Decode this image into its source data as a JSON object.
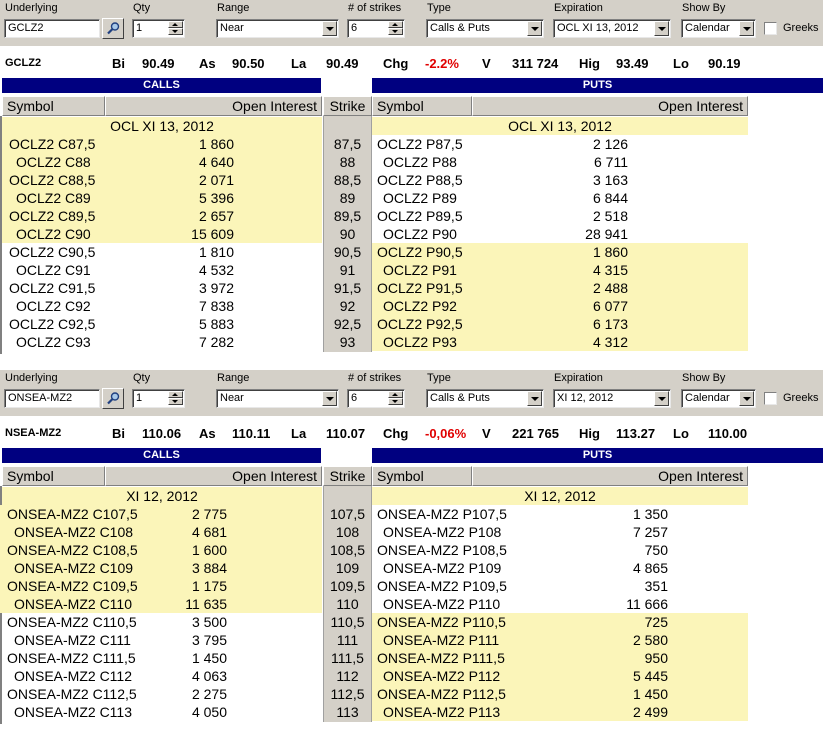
{
  "labels": {
    "underlying": "Underlying",
    "qty": "Qty",
    "range": "Range",
    "strikes": "# of strikes",
    "type": "Type",
    "expiration": "Expiration",
    "show_by": "Show By",
    "greeks": "Greeks",
    "calls": "CALLS",
    "puts": "PUTS",
    "symbol": "Symbol",
    "open_interest": "Open Interest",
    "strike": "Strike",
    "bid": "Bi",
    "ask": "As",
    "last": "La",
    "chg": "Chg",
    "vol": "V",
    "high": "Hig",
    "low": "Lo"
  },
  "panels": [
    {
      "underlying": "GCLZ2",
      "qty": "1",
      "range": "Near",
      "strikes": "6",
      "type": "Calls & Puts",
      "expiration": "OCL XI 13, 2012",
      "show_by": "Calendar",
      "quote": {
        "symbol": "GCLZ2",
        "bid": "90.49",
        "ask": "90.50",
        "last": "90.49",
        "chg": "-2.2%",
        "vol": "311 724",
        "high": "93.49",
        "low": "90.19"
      },
      "expiry_label": "OCL XI 13, 2012",
      "rows": [
        {
          "call": "OCLZ2 C87,5",
          "call_oi": "1 860",
          "strike": "87,5",
          "put": "OCLZ2 P87,5",
          "put_oi": "2 126",
          "call_itm": true,
          "put_itm": false
        },
        {
          "call": "OCLZ2 C88",
          "call_oi": "4 640",
          "strike": "88",
          "put": "OCLZ2 P88",
          "put_oi": "6 711",
          "call_itm": true,
          "put_itm": false
        },
        {
          "call": "OCLZ2 C88,5",
          "call_oi": "2 071",
          "strike": "88,5",
          "put": "OCLZ2 P88,5",
          "put_oi": "3 163",
          "call_itm": true,
          "put_itm": false
        },
        {
          "call": "OCLZ2 C89",
          "call_oi": "5 396",
          "strike": "89",
          "put": "OCLZ2 P89",
          "put_oi": "6 844",
          "call_itm": true,
          "put_itm": false
        },
        {
          "call": "OCLZ2 C89,5",
          "call_oi": "2 657",
          "strike": "89,5",
          "put": "OCLZ2 P89,5",
          "put_oi": "2 518",
          "call_itm": true,
          "put_itm": false
        },
        {
          "call": "OCLZ2 C90",
          "call_oi": "15 609",
          "strike": "90",
          "put": "OCLZ2 P90",
          "put_oi": "28 941",
          "call_itm": true,
          "put_itm": false
        },
        {
          "call": "OCLZ2 C90,5",
          "call_oi": "1 810",
          "strike": "90,5",
          "put": "OCLZ2 P90,5",
          "put_oi": "1 860",
          "call_itm": false,
          "put_itm": true
        },
        {
          "call": "OCLZ2 C91",
          "call_oi": "4 532",
          "strike": "91",
          "put": "OCLZ2 P91",
          "put_oi": "4 315",
          "call_itm": false,
          "put_itm": true
        },
        {
          "call": "OCLZ2 C91,5",
          "call_oi": "3 972",
          "strike": "91,5",
          "put": "OCLZ2 P91,5",
          "put_oi": "2 488",
          "call_itm": false,
          "put_itm": true
        },
        {
          "call": "OCLZ2 C92",
          "call_oi": "7 838",
          "strike": "92",
          "put": "OCLZ2 P92",
          "put_oi": "6 077",
          "call_itm": false,
          "put_itm": true
        },
        {
          "call": "OCLZ2 C92,5",
          "call_oi": "5 883",
          "strike": "92,5",
          "put": "OCLZ2 P92,5",
          "put_oi": "6 173",
          "call_itm": false,
          "put_itm": true
        },
        {
          "call": "OCLZ2 C93",
          "call_oi": "7 282",
          "strike": "93",
          "put": "OCLZ2 P93",
          "put_oi": "4 312",
          "call_itm": false,
          "put_itm": true
        }
      ]
    },
    {
      "underlying": "ONSEA-MZ2",
      "qty": "1",
      "range": "Near",
      "strikes": "6",
      "type": "Calls & Puts",
      "expiration": "XI 12, 2012",
      "show_by": "Calendar",
      "quote": {
        "symbol": "NSEA-MZ2",
        "bid": "110.06",
        "ask": "110.11",
        "last": "110.07",
        "chg": "-0,06%",
        "vol": "221 765",
        "high": "113.27",
        "low": "110.00"
      },
      "expiry_label": "XI 12, 2012",
      "rows": [
        {
          "call": "ONSEA-MZ2 C107,5",
          "call_oi": "2 775",
          "strike": "107,5",
          "put": "ONSEA-MZ2 P107,5",
          "put_oi": "1 350",
          "call_itm": true,
          "put_itm": false
        },
        {
          "call": "ONSEA-MZ2 C108",
          "call_oi": "4 681",
          "strike": "108",
          "put": "ONSEA-MZ2 P108",
          "put_oi": "7 257",
          "call_itm": true,
          "put_itm": false
        },
        {
          "call": "ONSEA-MZ2 C108,5",
          "call_oi": "1 600",
          "strike": "108,5",
          "put": "ONSEA-MZ2 P108,5",
          "put_oi": "750",
          "call_itm": true,
          "put_itm": false
        },
        {
          "call": "ONSEA-MZ2 C109",
          "call_oi": "3 884",
          "strike": "109",
          "put": "ONSEA-MZ2 P109",
          "put_oi": "4 865",
          "call_itm": true,
          "put_itm": false
        },
        {
          "call": "ONSEA-MZ2 C109,5",
          "call_oi": "1 175",
          "strike": "109,5",
          "put": "ONSEA-MZ2 P109,5",
          "put_oi": "351",
          "call_itm": true,
          "put_itm": false
        },
        {
          "call": "ONSEA-MZ2 C110",
          "call_oi": "11 635",
          "strike": "110",
          "put": "ONSEA-MZ2 P110",
          "put_oi": "11 666",
          "call_itm": true,
          "put_itm": false
        },
        {
          "call": "ONSEA-MZ2 C110,5",
          "call_oi": "3 500",
          "strike": "110,5",
          "put": "ONSEA-MZ2 P110,5",
          "put_oi": "725",
          "call_itm": false,
          "put_itm": true
        },
        {
          "call": "ONSEA-MZ2 C111",
          "call_oi": "3 795",
          "strike": "111",
          "put": "ONSEA-MZ2 P111",
          "put_oi": "2 580",
          "call_itm": false,
          "put_itm": true
        },
        {
          "call": "ONSEA-MZ2 C111,5",
          "call_oi": "1 450",
          "strike": "111,5",
          "put": "ONSEA-MZ2 P111,5",
          "put_oi": "950",
          "call_itm": false,
          "put_itm": true
        },
        {
          "call": "ONSEA-MZ2 C112",
          "call_oi": "4 063",
          "strike": "112",
          "put": "ONSEA-MZ2 P112",
          "put_oi": "5 445",
          "call_itm": false,
          "put_itm": true
        },
        {
          "call": "ONSEA-MZ2 C112,5",
          "call_oi": "2 275",
          "strike": "112,5",
          "put": "ONSEA-MZ2 P112,5",
          "put_oi": "1 450",
          "call_itm": false,
          "put_itm": true
        },
        {
          "call": "ONSEA-MZ2 C113",
          "call_oi": "4 050",
          "strike": "113",
          "put": "ONSEA-MZ2 P113",
          "put_oi": "2 499",
          "call_itm": false,
          "put_itm": true
        }
      ]
    }
  ],
  "colors": {
    "itm_highlight": "#fbf5b9",
    "section_bar": "#000080",
    "negative_change": "#e00000",
    "chrome": "#d4d0c8"
  }
}
